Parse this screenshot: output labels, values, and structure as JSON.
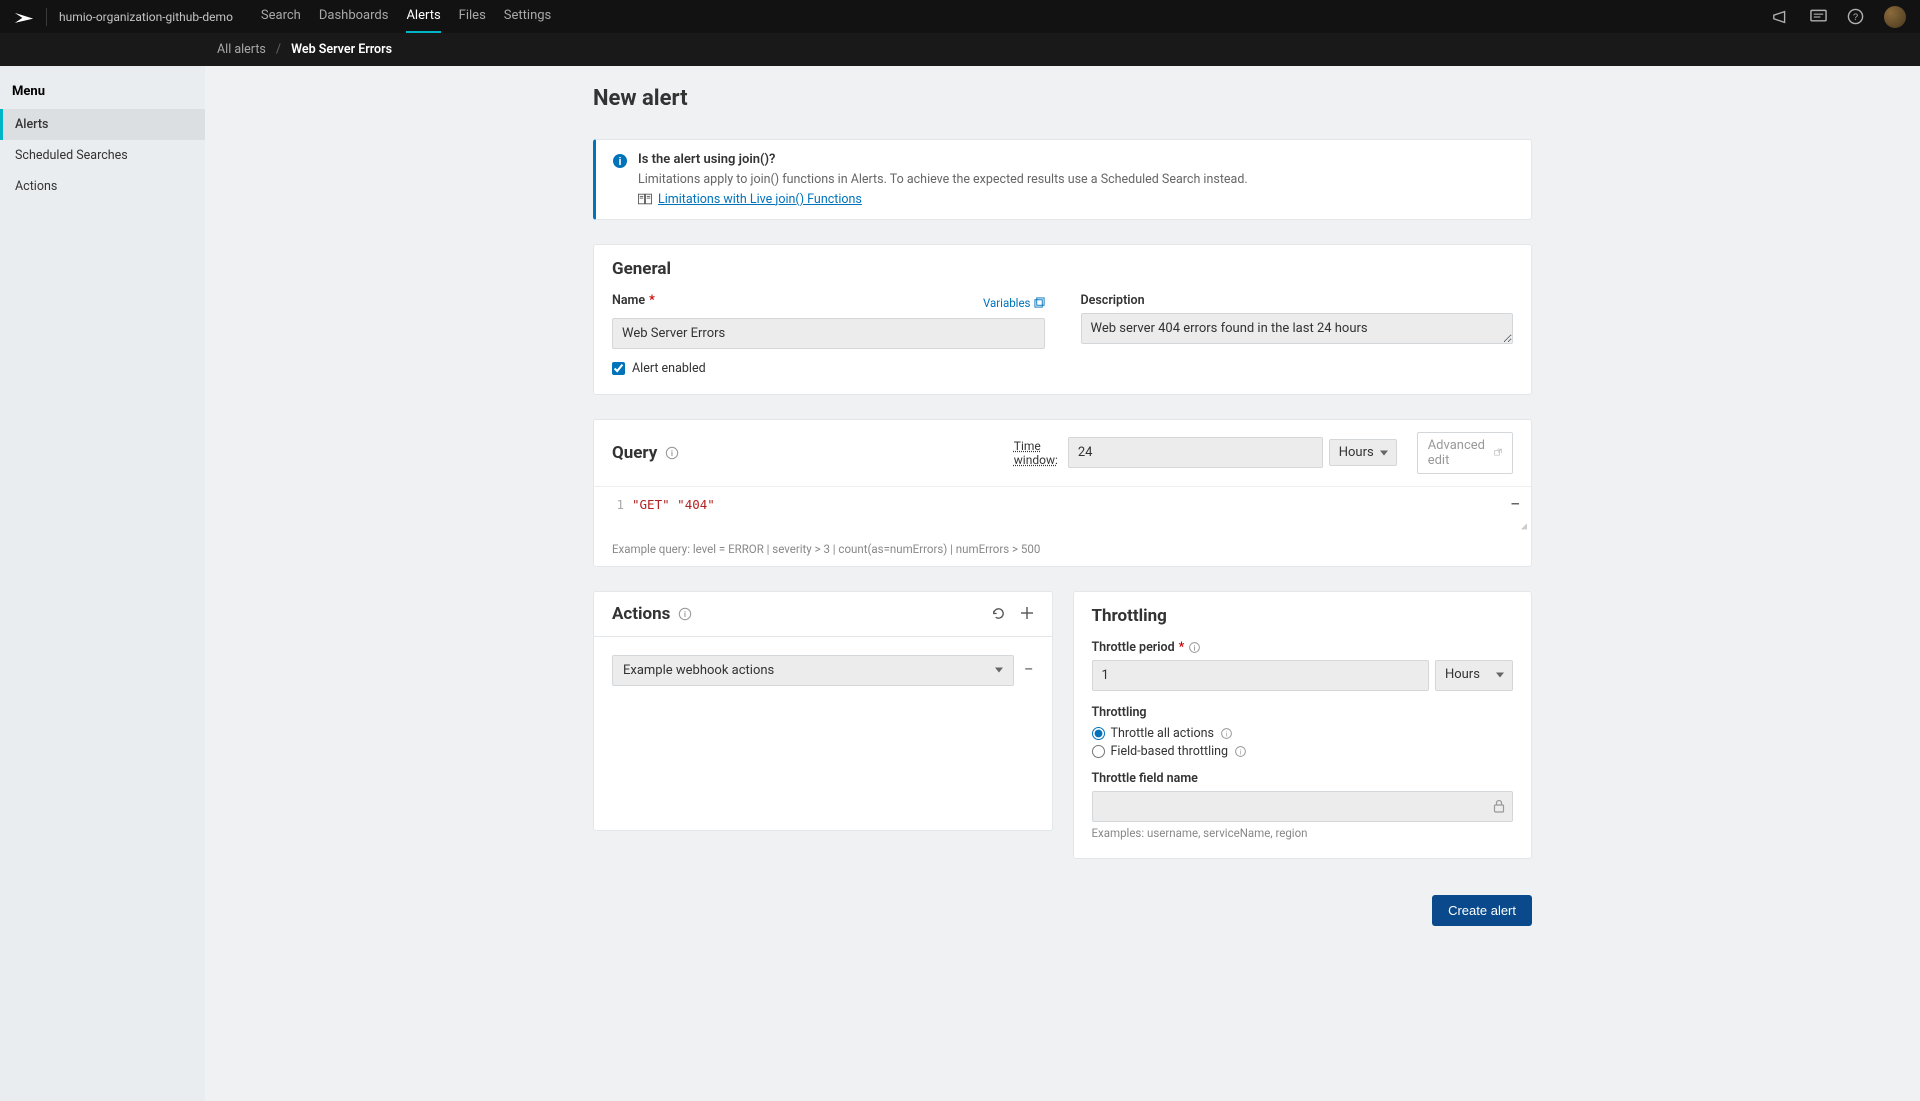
{
  "org": "humio-organization-github-demo",
  "topnav": [
    "Search",
    "Dashboards",
    "Alerts",
    "Files",
    "Settings"
  ],
  "topnav_active": "Alerts",
  "breadcrumb": {
    "parent": "All alerts",
    "current": "Web Server Errors"
  },
  "sidebar": {
    "heading": "Menu",
    "items": [
      "Alerts",
      "Scheduled Searches",
      "Actions"
    ],
    "active": "Alerts"
  },
  "page_title": "New alert",
  "banner": {
    "heading": "Is the alert using join()?",
    "text": "Limitations apply to join() functions in Alerts. To achieve the expected results use a Scheduled Search instead.",
    "link": "Limitations with Live join() Functions"
  },
  "general": {
    "title": "General",
    "name_label": "Name",
    "variables_link": "Variables",
    "name_value": "Web Server Errors",
    "description_label": "Description",
    "description_value": "Web server 404 errors found in the last 24 hours",
    "enabled_label": "Alert enabled",
    "enabled": true
  },
  "query": {
    "title": "Query",
    "time_window_label": "Time window:",
    "time_value": "24",
    "time_unit": "Hours",
    "advanced_edit": "Advanced edit",
    "line_no": "1",
    "code_tokens": [
      "\"GET\"",
      "\"404\""
    ],
    "example": "Example query: level = ERROR | severity > 3 | count(as=numErrors) | numErrors > 500"
  },
  "actions": {
    "title": "Actions",
    "selected": "Example webhook actions"
  },
  "throttling": {
    "title": "Throttling",
    "period_label": "Throttle period",
    "period_value": "1",
    "period_unit": "Hours",
    "sub_heading": "Throttling",
    "option_all": "Throttle all actions",
    "option_field": "Field-based throttling",
    "field_label": "Throttle field name",
    "examples": "Examples: username, serviceName, region"
  },
  "create_button": "Create alert"
}
